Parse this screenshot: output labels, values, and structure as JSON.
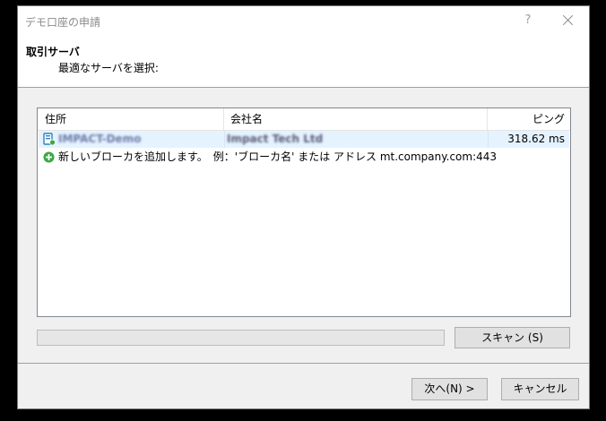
{
  "window": {
    "title": "デモ口座の申請",
    "help_label": "?"
  },
  "header": {
    "title": "取引サーバ",
    "subtitle": "最適なサーバを選択:"
  },
  "server_list": {
    "columns": [
      "住所",
      "会社名",
      "ピング"
    ],
    "rows": [
      {
        "address": "IMPACT-Demo",
        "company": "Impact Tech Ltd",
        "ping": "318.62 ms",
        "selected": true
      }
    ],
    "add_broker_text": "新しいブローカを追加します。　例：'ブローカ名' または アドレス mt.company.com:443"
  },
  "scan": {
    "button_label": "スキャン (S)",
    "progress": 0
  },
  "footer": {
    "next_label": "次へ(N) >",
    "cancel_label": "キャンセル"
  },
  "colors": {
    "selection": "#e5f3ff",
    "add_icon": "#3aa845",
    "server_icon": "#2a82c4"
  },
  "icons": {
    "server": "server-icon",
    "add": "add-icon",
    "close": "close-icon"
  }
}
